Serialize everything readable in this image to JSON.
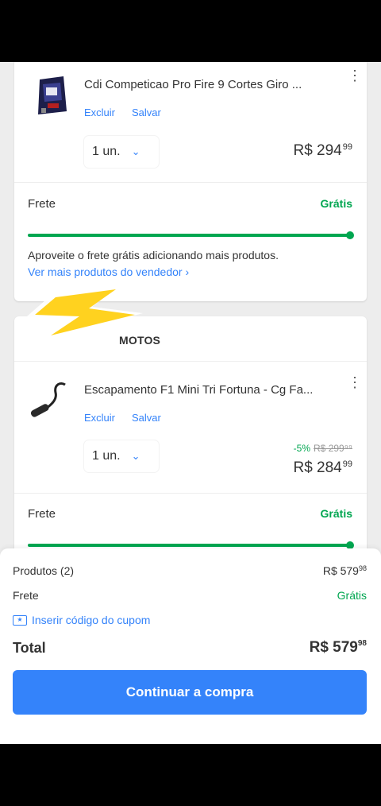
{
  "cart": {
    "items": [
      {
        "title": "Cdi Competicao Pro Fire 9 Cortes Giro ...",
        "delete_label": "Excluir",
        "save_label": "Salvar",
        "quantity": "1 un.",
        "price_int": "R$ 294",
        "price_cents": "99",
        "shipping_label": "Frete",
        "shipping_value": "Grátis",
        "free_shipping_msg": "Aproveite o frete grátis adicionando mais produtos.",
        "seller_link": "Ver mais produtos do vendedor ›",
        "shipping_progress": 1.0
      },
      {
        "seller": "MOTOS",
        "title": "Escapamento F1 Mini Tri Fortuna - Cg Fa...",
        "delete_label": "Excluir",
        "save_label": "Salvar",
        "quantity": "1 un.",
        "discount": "-5%",
        "old_price": "R$ 299⁹⁹",
        "price_int": "R$ 284",
        "price_cents": "99",
        "shipping_label": "Frete",
        "shipping_value": "Grátis",
        "shipping_progress": 1.0
      }
    ]
  },
  "summary": {
    "products_label": "Produtos (2)",
    "products_value_int": "R$ 579",
    "products_value_cents": "98",
    "shipping_label": "Frete",
    "shipping_value": "Grátis",
    "coupon_label": "Inserir código do cupom",
    "total_label": "Total",
    "total_value_int": "R$ 579",
    "total_value_cents": "98",
    "cta_label": "Continuar a compra"
  },
  "colors": {
    "accent": "#3483fa",
    "green": "#00a650",
    "bolt": "#ffd21f"
  },
  "icons": [
    "more-vert-icon",
    "chevron-down-icon",
    "coupon-icon",
    "lightning-bolt-icon"
  ]
}
